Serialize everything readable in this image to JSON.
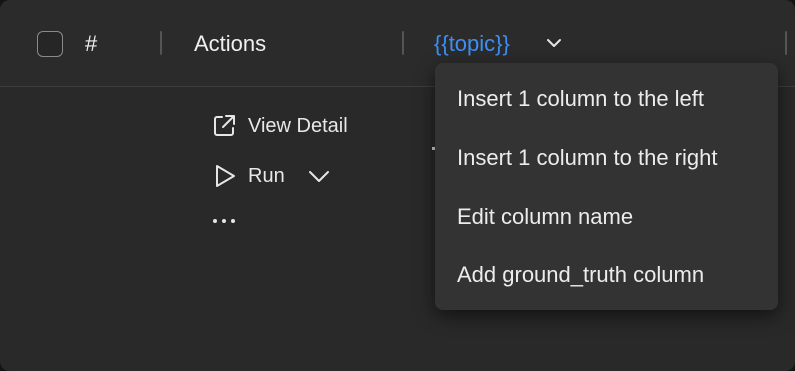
{
  "header": {
    "index_label": "#",
    "actions_label": "Actions",
    "topic_label": "{{topic}}",
    "topic_color": "#3d8ff5"
  },
  "row_actions": {
    "view_detail_label": "View Detail",
    "run_label": "Run",
    "more_label": "..."
  },
  "column_menu": {
    "items": [
      "Insert 1 column to the left",
      "Insert 1 column to the right",
      "Edit column name",
      "Add ground_truth column"
    ]
  },
  "icons": {
    "open_external": "external-link-icon",
    "run": "play-icon",
    "run_dropdown": "chevron-down-icon",
    "more": "ellipsis-icon",
    "topic_dropdown": "chevron-down-icon"
  }
}
